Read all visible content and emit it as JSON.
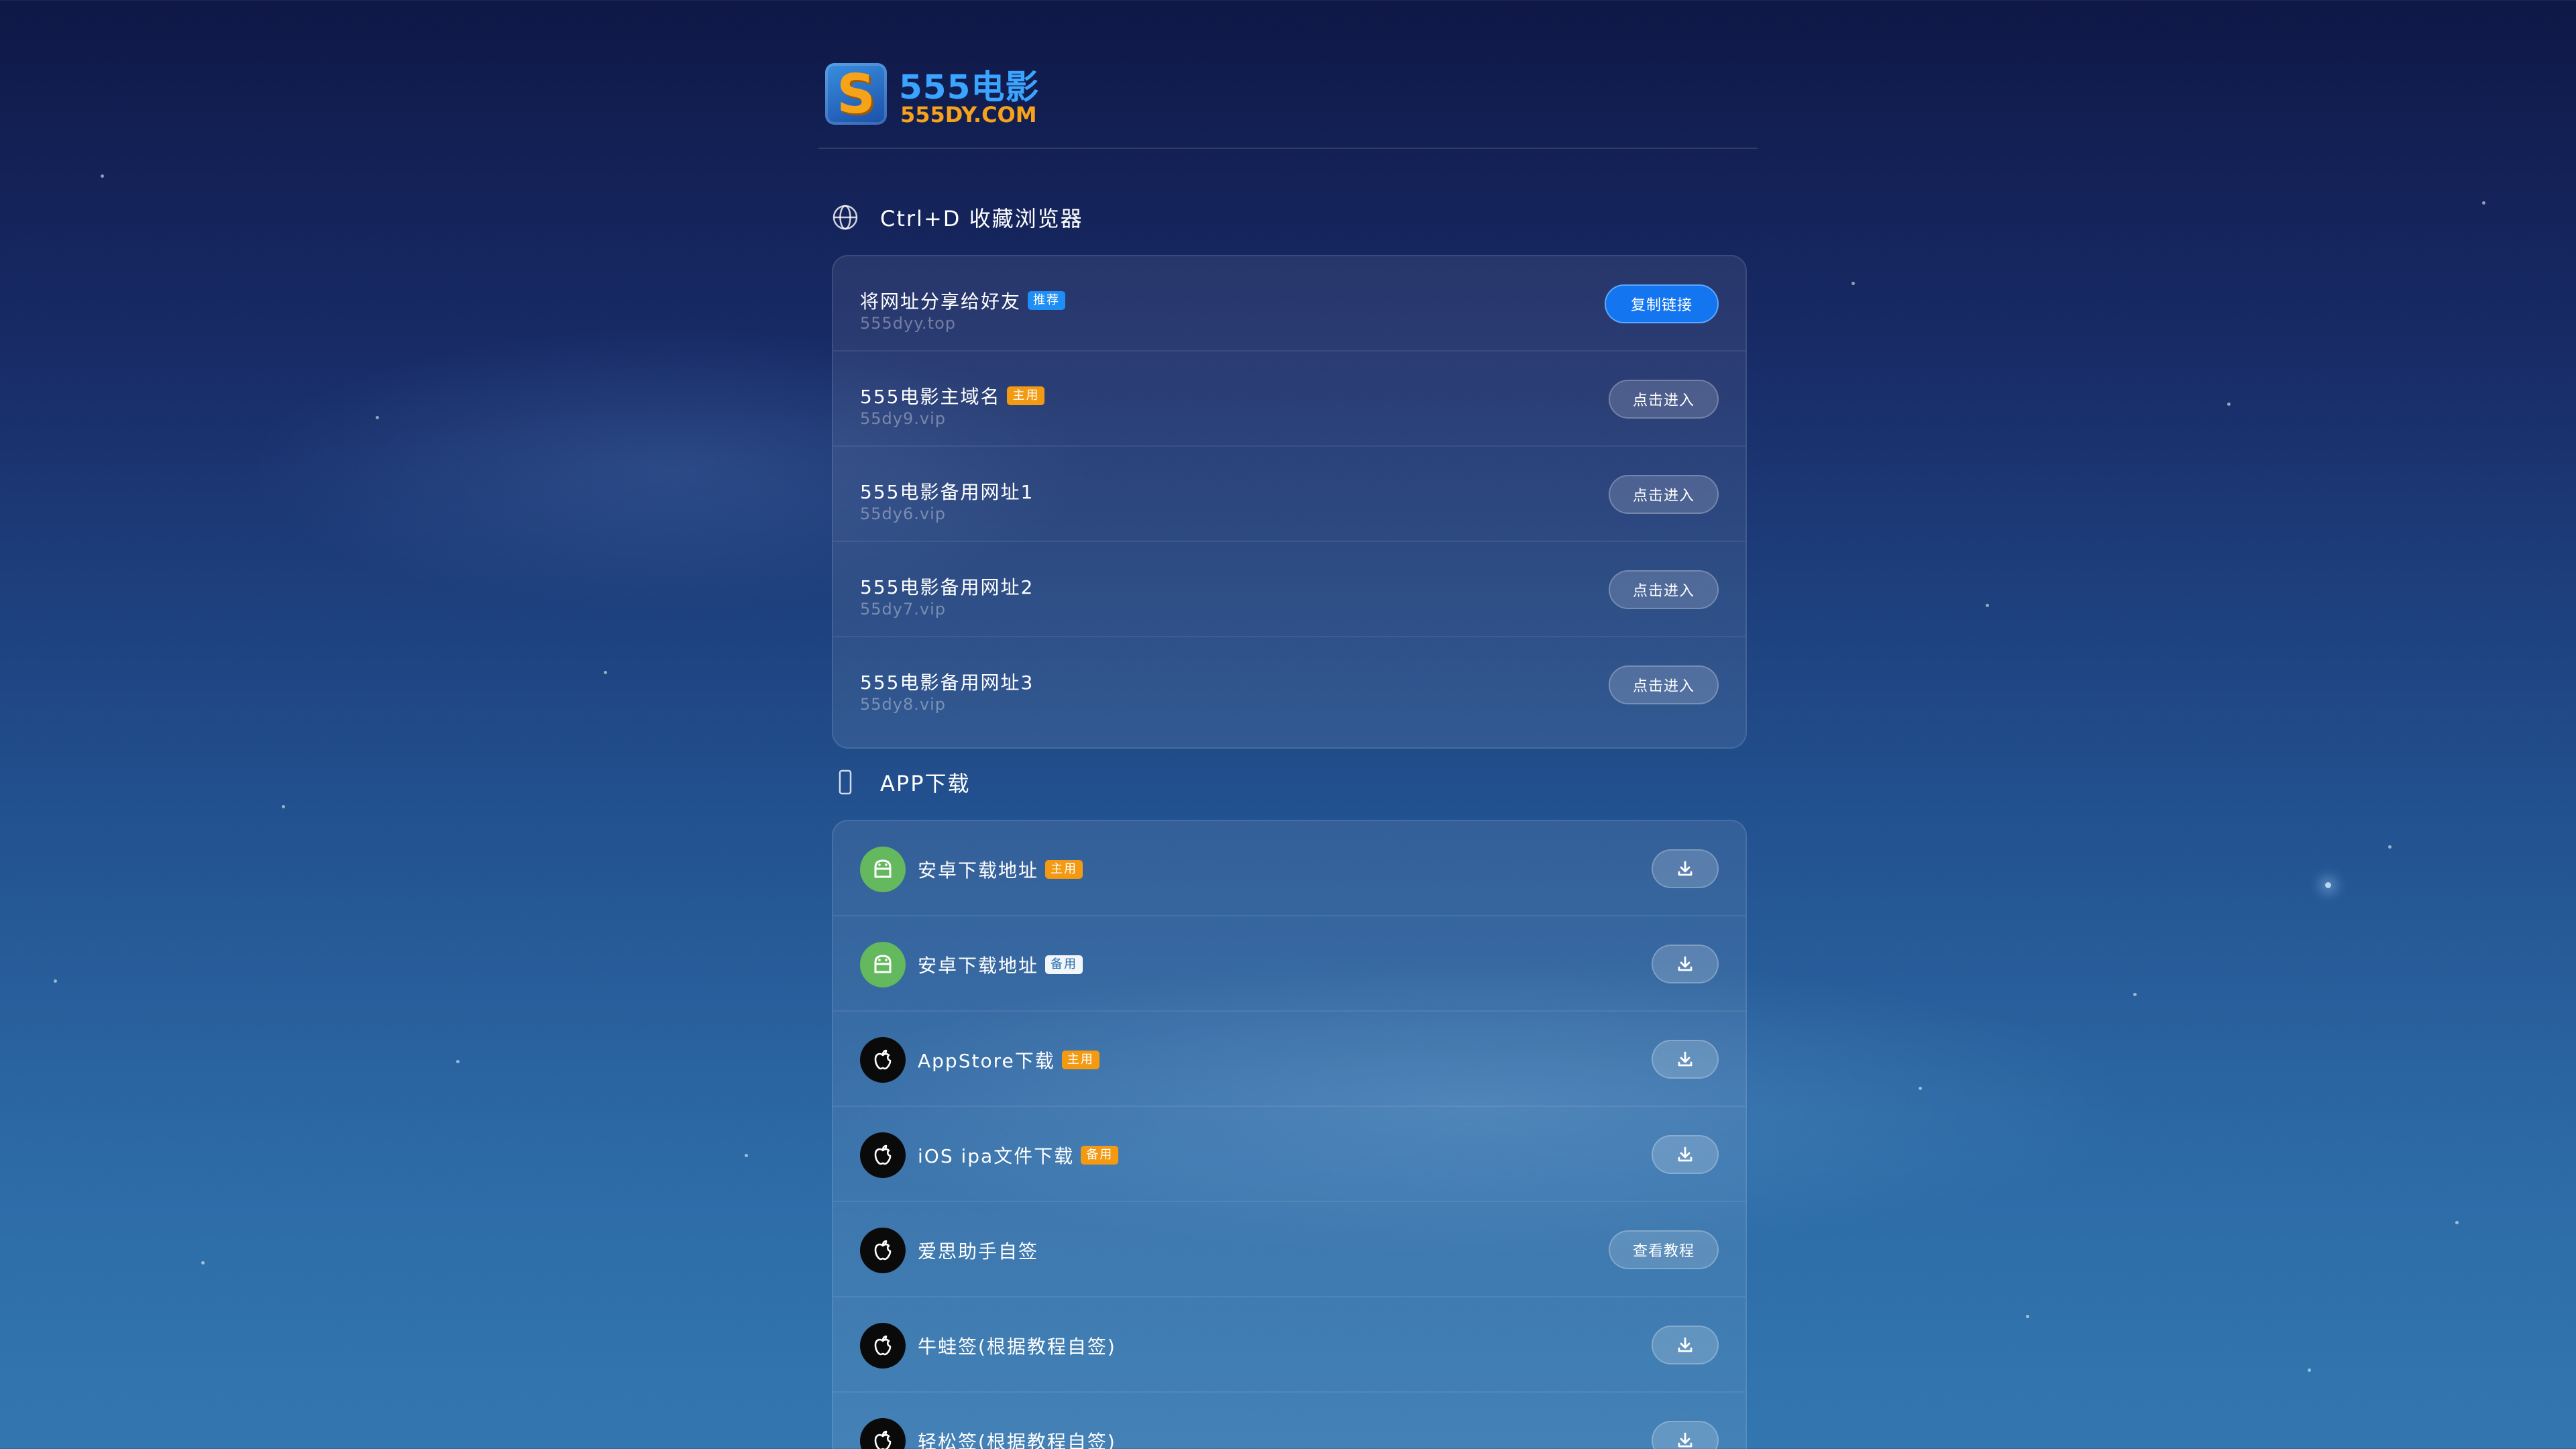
{
  "brand": {
    "logo_letter": "S",
    "title": "555电影",
    "domain": "555DY.COM"
  },
  "bookmark_section": {
    "title": "Ctrl+D 收藏浏览器",
    "icon": "globe-icon"
  },
  "links": [
    {
      "name": "将网址分享给好友",
      "badge": "推荐",
      "badge_color": "#1f8ff5",
      "url": "555dyy.top",
      "button": "复制链接"
    },
    {
      "name": "555电影主域名",
      "badge": "主用",
      "badge_color": "#f39a12",
      "url": "55dy9.vip",
      "button": "点击进入"
    },
    {
      "name": "555电影备用网址1",
      "badge": "",
      "url": "55dy6.vip",
      "button": "点击进入"
    },
    {
      "name": "555电影备用网址2",
      "badge": "",
      "url": "55dy7.vip",
      "button": "点击进入"
    },
    {
      "name": "555电影备用网址3",
      "badge": "",
      "url": "55dy8.vip",
      "button": "点击进入"
    }
  ],
  "app_section": {
    "title": "APP下载",
    "icon": "phone-icon"
  },
  "apps": [
    {
      "name": "安卓下载地址",
      "badge": "主用",
      "badge_color": "#f39a12",
      "platform_icon": "android-icon",
      "action_icon": "download-icon"
    },
    {
      "name": "安卓下载地址",
      "badge": "备用",
      "badge_color": "#f2f6fa",
      "platform_icon": "android-icon",
      "action_icon": "download-icon"
    },
    {
      "name": "AppStore下载",
      "badge": "主用",
      "badge_color": "#f39a12",
      "platform_icon": "apple-icon",
      "action_icon": "download-icon"
    },
    {
      "name": "iOS ipa文件下载",
      "badge": "备用",
      "badge_color": "#f39a12",
      "platform_icon": "apple-icon",
      "action_icon": "download-icon"
    },
    {
      "name": "爱思助手自签",
      "badge": "",
      "platform_icon": "apple-icon",
      "button": "查看教程"
    },
    {
      "name": "牛蛙签(根据教程自签)",
      "badge": "",
      "platform_icon": "apple-icon",
      "action_icon": "download-icon"
    },
    {
      "name": "轻松签(根据教程自签)",
      "badge": "",
      "platform_icon": "apple-icon",
      "action_icon": "download-icon"
    }
  ],
  "colors": {
    "primary_button": "#1475f0",
    "badge_orange": "#f39a12",
    "badge_blue": "#1f8ff5",
    "brand_blue": "#3ba4ff",
    "brand_orange": "#f7a31a",
    "android_green": "#64b85e"
  }
}
